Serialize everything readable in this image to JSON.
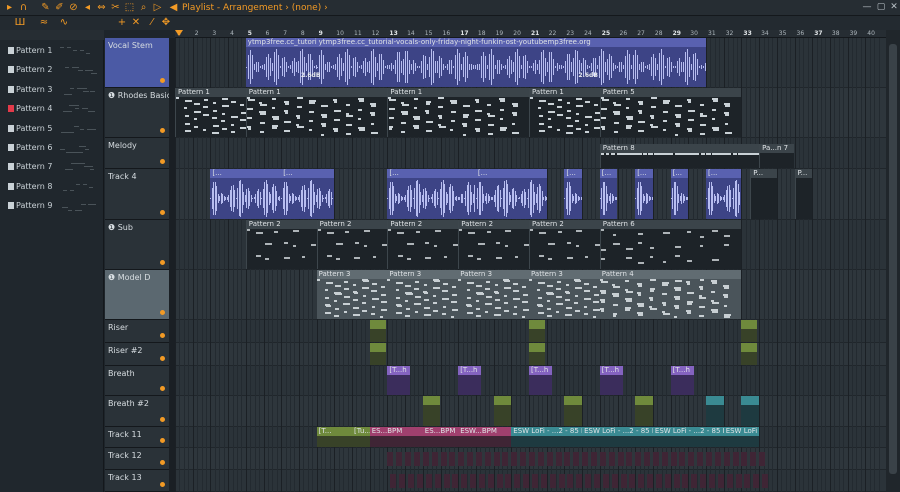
{
  "window": {
    "title": "Playlist - Arrangement",
    "pattern_select": "(none)",
    "separator": "›"
  },
  "toolbar": {
    "icons": [
      "menu-icon",
      "magnet-icon",
      "draw-icon",
      "paint-icon",
      "delete-icon",
      "mute-icon",
      "slip-icon",
      "slice-icon",
      "select-icon",
      "zoom-icon",
      "playback-icon"
    ]
  },
  "picker": {
    "patterns": [
      {
        "label": "Pattern 1",
        "color": "#c9d1d6"
      },
      {
        "label": "Pattern 2",
        "color": "#c9d1d6"
      },
      {
        "label": "Pattern 3",
        "color": "#c9d1d6"
      },
      {
        "label": "Pattern 4",
        "color": "#e33a4a"
      },
      {
        "label": "Pattern 5",
        "color": "#c9d1d6"
      },
      {
        "label": "Pattern 6",
        "color": "#c9d1d6"
      },
      {
        "label": "Pattern 7",
        "color": "#c9d1d6"
      },
      {
        "label": "Pattern 8",
        "color": "#c9d1d6"
      },
      {
        "label": "Pattern 9",
        "color": "#c9d1d6"
      }
    ]
  },
  "ruler": {
    "numbers": [
      "1",
      "2",
      "3",
      "4",
      "5",
      "6",
      "7",
      "8",
      "9",
      "10",
      "11",
      "12",
      "13",
      "14",
      "15",
      "16",
      "17",
      "18",
      "19",
      "20",
      "21",
      "22",
      "23",
      "24",
      "25",
      "26",
      "27",
      "28",
      "29",
      "30",
      "31",
      "32",
      "33",
      "34",
      "35",
      "36",
      "37",
      "38",
      "39",
      "40"
    ],
    "bold": [
      "5",
      "9",
      "13",
      "17",
      "21",
      "25",
      "29",
      "33",
      "37"
    ]
  },
  "tracks": [
    {
      "name": "Vocal Stem",
      "style": "sel"
    },
    {
      "name": "❶ Rhodes Basic",
      "style": ""
    },
    {
      "name": "Melody",
      "style": ""
    },
    {
      "name": "Track 4",
      "style": ""
    },
    {
      "name": "❶ Sub",
      "style": ""
    },
    {
      "name": "❶ Model D",
      "style": "sel2"
    },
    {
      "name": "Riser",
      "style": ""
    },
    {
      "name": "Riser #2",
      "style": ""
    },
    {
      "name": "Breath",
      "style": ""
    },
    {
      "name": "Breath #2",
      "style": ""
    },
    {
      "name": "Track 11",
      "style": ""
    },
    {
      "name": "Track 12",
      "style": ""
    },
    {
      "name": "Track 13",
      "style": ""
    }
  ],
  "clips": {
    "vocal_1": "ytmp3free.cc_tutori...-youtubemp3free.org",
    "vocal_2": "ytmp3free.cc_tutorial-vocals-only-friday-night-funkin-ost-youtubemp3free.org",
    "gain_1": "2.6dB",
    "gain_2": "2.6dB",
    "rhodes": [
      "Pattern 1",
      "Pattern 1",
      "Pattern 1",
      "Pattern 1",
      "Pattern 5"
    ],
    "melody": [
      "Pattern 8",
      "Pa...n 7"
    ],
    "track4_short": "[...",
    "track4_tail": "P...",
    "sub": [
      "Pattern 2",
      "Pattern 2",
      "Pattern 2",
      "Pattern 2",
      "Pattern 2",
      "Pattern 6"
    ],
    "model_d": [
      "Pattern 3",
      "Pattern 3",
      "Pattern 3",
      "Pattern 3",
      "Pattern 4"
    ],
    "breath": "[T...h",
    "track11_left": "[T...",
    "track11_mid": "[Tu...l",
    "track11_es1": "ES...BPM",
    "track11_es2": "ES...BPM",
    "track11_esw": "ESW...BPM",
    "track11_lofi": "ESW LoFi - ...2 - 85 BPM"
  },
  "colors": {
    "accent": "#f29a25",
    "vocal": "#5961b0",
    "riser": "#6f8a3c",
    "breath": "#8463c0",
    "breath2": "#3a8a92",
    "track11": "#a0406e"
  }
}
